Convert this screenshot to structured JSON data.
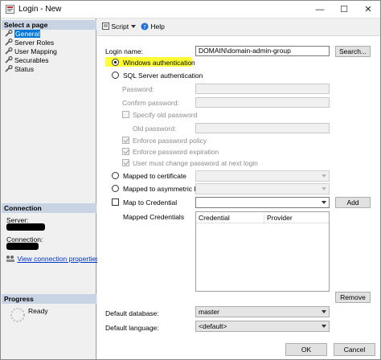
{
  "window": {
    "title": "Login - New",
    "minimize": "—",
    "maximize": "☐",
    "close": "✕"
  },
  "sidebar": {
    "select_header": "Select a page",
    "items": [
      {
        "label": "General",
        "selected": true
      },
      {
        "label": "Server Roles"
      },
      {
        "label": "User Mapping"
      },
      {
        "label": "Securables"
      },
      {
        "label": "Status"
      }
    ],
    "connection_header": "Connection",
    "server_label": "Server:",
    "connection_label": "Connection:",
    "view_connection": "View connection properties",
    "progress_header": "Progress",
    "progress_status": "Ready"
  },
  "toolbar": {
    "script": "Script",
    "help": "Help"
  },
  "form": {
    "login_name_label": "Login name:",
    "login_name_value": "DOMAIN\\domain-admin-group",
    "search_button": "Search...",
    "windows_auth": "Windows authentication",
    "sql_auth": "SQL Server authentication",
    "password": "Password:",
    "confirm_password": "Confirm password:",
    "specify_old": "Specify old password",
    "old_password": "Old password:",
    "enforce_policy": "Enforce password policy",
    "enforce_expiration": "Enforce password expiration",
    "must_change": "User must change password at next login",
    "mapped_cert": "Mapped to certificate",
    "mapped_asym": "Mapped to asymmetric key",
    "map_credential": "Map to Credential",
    "add_button": "Add",
    "mapped_credentials": "Mapped Credentials",
    "grid_col_credential": "Credential",
    "grid_col_provider": "Provider",
    "remove_button": "Remove",
    "default_db_label": "Default database:",
    "default_db_value": "master",
    "default_lang_label": "Default language:",
    "default_lang_value": "<default>"
  },
  "buttons": {
    "ok": "OK",
    "cancel": "Cancel"
  },
  "colors": {
    "selected": "#0078d7",
    "header": "#c8d4e4",
    "highlight": "#ffff33"
  }
}
